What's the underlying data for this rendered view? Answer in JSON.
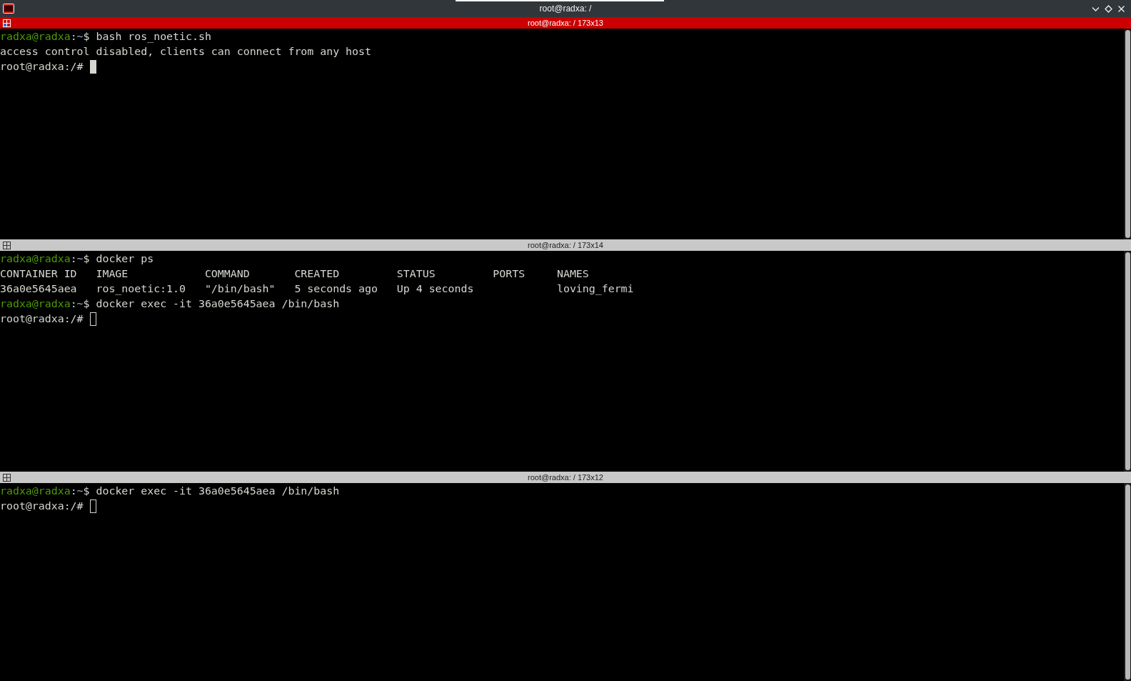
{
  "window": {
    "title": "root@radxa: /"
  },
  "panes": [
    {
      "title": "root@radxa: / 173x13",
      "focused": true,
      "lines": [
        {
          "cursor": false,
          "segments": [
            {
              "kind": "user",
              "text": "radxa@radxa"
            },
            {
              "kind": "plain",
              "text": ":"
            },
            {
              "kind": "path",
              "text": "~"
            },
            {
              "kind": "plain",
              "text": "$ bash ros_noetic.sh"
            }
          ]
        },
        {
          "cursor": false,
          "segments": [
            {
              "kind": "plain",
              "text": "access control disabled, clients can connect from any host"
            }
          ]
        },
        {
          "cursor": true,
          "segments": [
            {
              "kind": "plain",
              "text": "root@radxa:/# "
            }
          ]
        }
      ]
    },
    {
      "title": "root@radxa: / 173x14",
      "focused": false,
      "lines": [
        {
          "cursor": false,
          "segments": [
            {
              "kind": "user",
              "text": "radxa@radxa"
            },
            {
              "kind": "plain",
              "text": ":"
            },
            {
              "kind": "path",
              "text": "~"
            },
            {
              "kind": "plain",
              "text": "$ docker ps"
            }
          ]
        },
        {
          "cursor": false,
          "segments": [
            {
              "kind": "plain",
              "text": "CONTAINER ID   IMAGE            COMMAND       CREATED         STATUS         PORTS     NAMES"
            }
          ]
        },
        {
          "cursor": false,
          "segments": [
            {
              "kind": "plain",
              "text": "36a0e5645aea   ros_noetic:1.0   \"/bin/bash\"   5 seconds ago   Up 4 seconds             loving_fermi"
            }
          ]
        },
        {
          "cursor": false,
          "segments": [
            {
              "kind": "user",
              "text": "radxa@radxa"
            },
            {
              "kind": "plain",
              "text": ":"
            },
            {
              "kind": "path",
              "text": "~"
            },
            {
              "kind": "plain",
              "text": "$ docker exec -it 36a0e5645aea /bin/bash"
            }
          ]
        },
        {
          "cursor": true,
          "segments": [
            {
              "kind": "plain",
              "text": "root@radxa:/# "
            }
          ]
        }
      ]
    },
    {
      "title": "root@radxa: / 173x12",
      "focused": false,
      "lines": [
        {
          "cursor": false,
          "segments": [
            {
              "kind": "user",
              "text": "radxa@radxa"
            },
            {
              "kind": "plain",
              "text": ":"
            },
            {
              "kind": "path",
              "text": "~"
            },
            {
              "kind": "plain",
              "text": "$ docker exec -it 36a0e5645aea /bin/bash"
            }
          ]
        },
        {
          "cursor": true,
          "segments": [
            {
              "kind": "plain",
              "text": "root@radxa:/# "
            }
          ]
        }
      ]
    }
  ]
}
